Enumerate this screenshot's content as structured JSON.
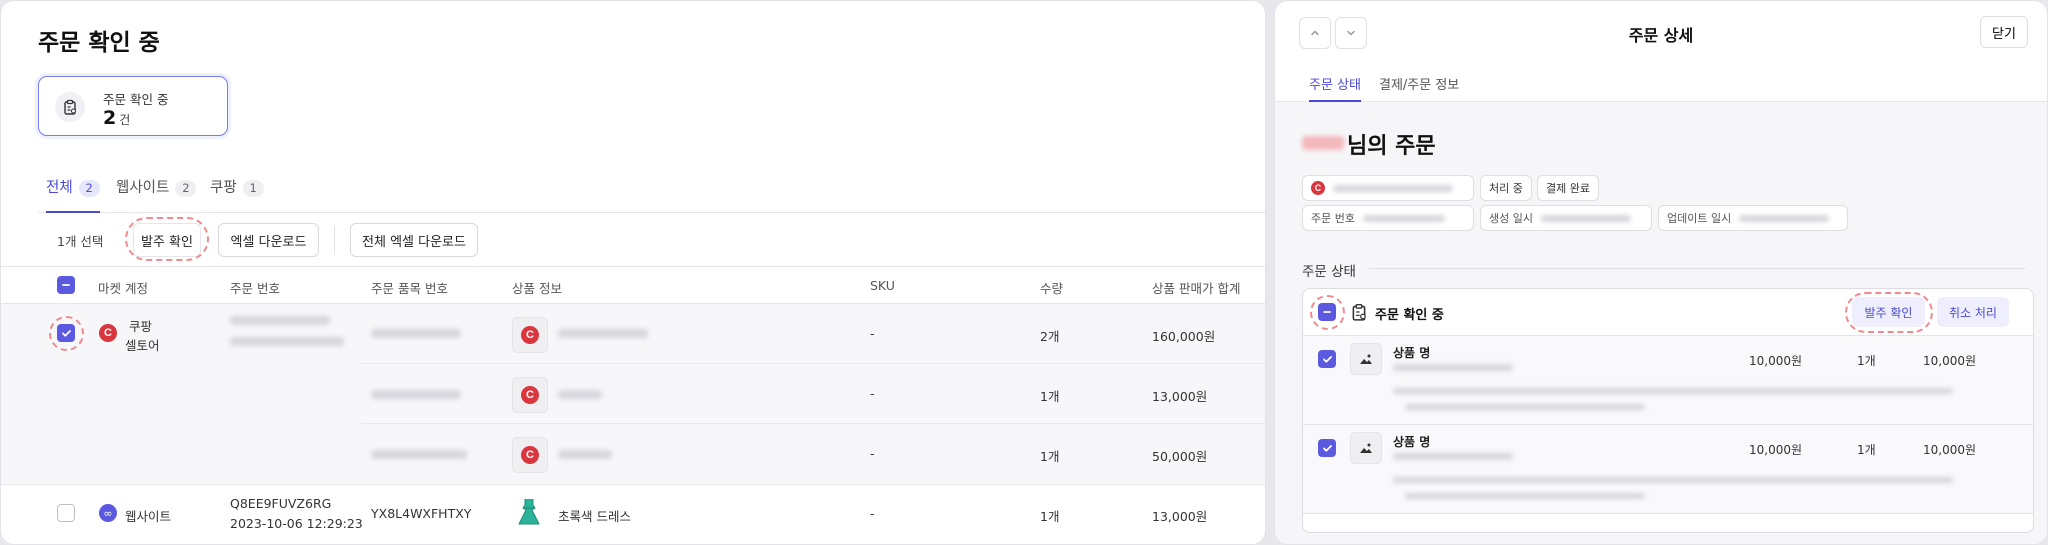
{
  "left": {
    "title": "주문 확인 중",
    "summary": {
      "label": "주문 확인 중",
      "count": "2",
      "unit": "건"
    },
    "tabs": [
      {
        "label": "전체",
        "count": "2"
      },
      {
        "label": "웹사이트",
        "count": "2"
      },
      {
        "label": "쿠팡",
        "count": "1"
      }
    ],
    "toolbar": {
      "selected": "1개 선택",
      "confirm": "발주 확인",
      "excel": "엑셀 다운로드",
      "excel_all": "전체 엑셀 다운로드"
    },
    "columns": [
      "마켓 계정",
      "주문 번호",
      "주문 품목 번호",
      "상품 정보",
      "SKU",
      "수량",
      "상품 판매가 합계"
    ],
    "coupang_order": {
      "market_line1": "쿠팡",
      "market_line2": "셀토어",
      "items": [
        {
          "sku": "-",
          "qty": "2개",
          "total": "160,000원"
        },
        {
          "sku": "-",
          "qty": "1개",
          "total": "13,000원"
        },
        {
          "sku": "-",
          "qty": "1개",
          "total": "50,000원"
        }
      ]
    },
    "web_order": {
      "market": "웹사이트",
      "order_no": "Q8EE9FUVZ6RG",
      "order_date": "2023-10-06 12:29:23",
      "item_no": "YX8L4WXFHTXY",
      "product": "초록색 드레스",
      "sku": "-",
      "qty": "1개",
      "total": "13,000원"
    }
  },
  "right": {
    "title": "주문 상세",
    "close": "닫기",
    "tabs": [
      "주문 상태",
      "결제/주문 정보"
    ],
    "heading": "님의 주문",
    "pills": {
      "processing": "처리 중",
      "paid": "결제 완료",
      "order_no": "주문 번호",
      "created": "생성 일시",
      "updated": "업데이트 일시"
    },
    "section": "주문 상태",
    "status": {
      "title": "주문 확인 중",
      "confirm": "발주 확인",
      "cancel": "취소 처리",
      "items": [
        {
          "name": "상품 명",
          "price": "10,000원",
          "qty": "1개",
          "total": "10,000원"
        },
        {
          "name": "상품 명",
          "price": "10,000원",
          "qty": "1개",
          "total": "10,000원"
        }
      ]
    }
  },
  "colors": {
    "accent": "#4a49d6",
    "highlight": "#f08a8f",
    "coupang": "#d9363e",
    "dress": "#2bb39a"
  },
  "icons": [
    "clipboard-icon",
    "coupang-logo-icon",
    "website-logo-icon",
    "dress-icon",
    "image-icon",
    "chevron-up-icon",
    "chevron-down-icon",
    "check-icon",
    "minus-icon"
  ]
}
